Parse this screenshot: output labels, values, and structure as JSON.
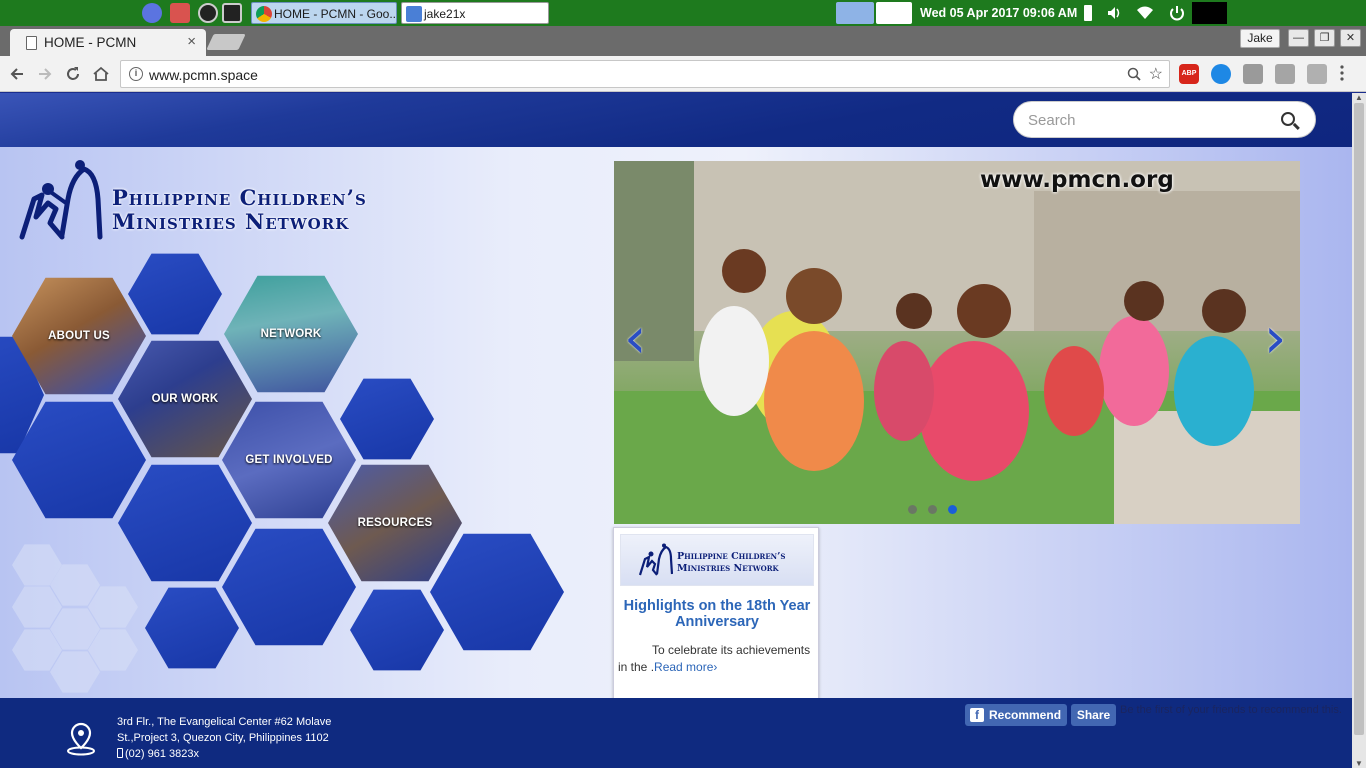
{
  "taskbar": {
    "tasks": [
      {
        "label": "HOME - PCMN - Goo..."
      },
      {
        "label": "jake21x"
      }
    ],
    "clock": "Wed 05 Apr 2017  09:06 AM"
  },
  "browser": {
    "tab_title": "HOME - PCMN",
    "close_glyph": "×",
    "user": "Jake",
    "url": "www.pcmn.space",
    "window_buttons": {
      "minimize": "—",
      "maximize": "❐",
      "close": "✕"
    }
  },
  "site": {
    "search_placeholder": "Search",
    "logo": {
      "line1": "Philippine Children’s",
      "line2": "Ministries Network"
    },
    "nav": [
      {
        "label": "ABOUT US"
      },
      {
        "label": "OUR WORK"
      },
      {
        "label": "NETWORK"
      },
      {
        "label": "GET INVOLVED"
      },
      {
        "label": "RESOURCES"
      }
    ],
    "carousel": {
      "banner_text": "www.pmcn.org",
      "prev_glyph": "‹",
      "next_glyph": "›",
      "active_slide": 3,
      "slide_count": 3
    },
    "news": {
      "thumb_line1": "Philippine Children’s",
      "thumb_line2": "Ministries Network",
      "title": "Highlights on the 18th Year Anniversary",
      "excerpt": "To celebrate its achievements in the .",
      "read_more": "Read more›"
    },
    "footer": {
      "address_line1": "3rd Flr., The Evangelical Center #62 Molave",
      "address_line2": "St.,Project 3, Quezon City, Philippines 1102",
      "phone": "(02) 961 3823x",
      "recommend_label": "Recommend",
      "share_label": "Share",
      "fb_note": "Be the first of your friends to recommend this."
    }
  },
  "colors": {
    "taskbar": "#1e7a1e",
    "header": "#112a84",
    "hex_blue": "#1736a6",
    "footer": "#0f2a80",
    "link": "#2c66b8"
  }
}
